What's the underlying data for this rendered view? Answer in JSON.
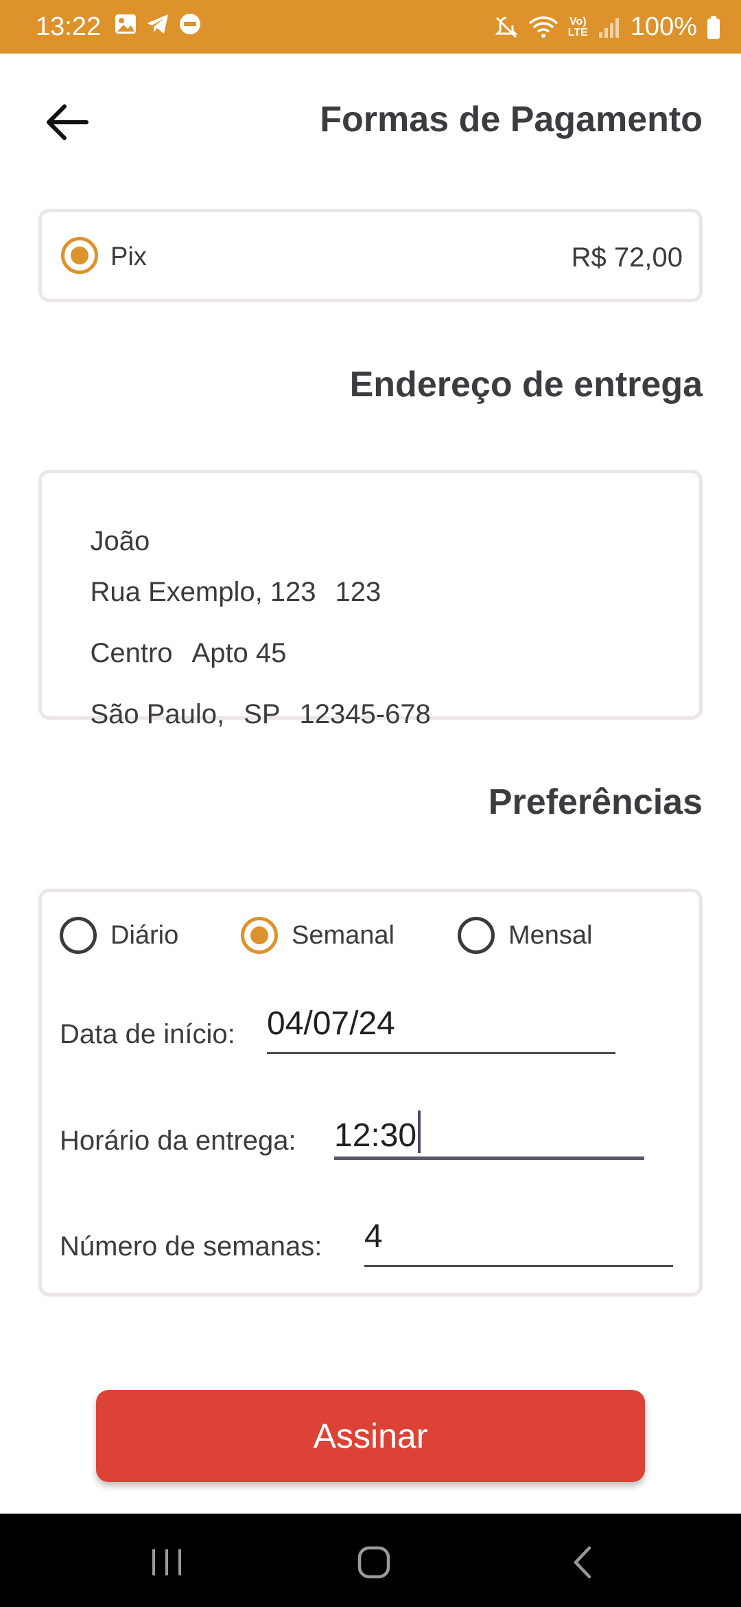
{
  "status_bar": {
    "time": "13:22",
    "battery_text": "100%",
    "icons": [
      "image-icon",
      "telegram-icon",
      "dnd-icon",
      "mute-icon",
      "wifi-icon",
      "volte-icon",
      "signal-icon",
      "battery-icon"
    ]
  },
  "header": {
    "title": "Formas de Pagamento",
    "back_icon": "arrow-left-icon"
  },
  "payment": {
    "method_label": "Pix",
    "price": "R$ 72,00",
    "selected": true
  },
  "address": {
    "title": "Endereço de entrega",
    "name": "João",
    "street": "Rua Exemplo, 123",
    "number": "123",
    "district": "Centro",
    "complement": "Apto 45",
    "city": "São Paulo,",
    "state": "SP",
    "zip": "12345-678"
  },
  "preferences": {
    "title": "Preferências",
    "frequency_options": [
      {
        "label": "Diário",
        "selected": false
      },
      {
        "label": "Semanal",
        "selected": true
      },
      {
        "label": "Mensal",
        "selected": false
      }
    ],
    "start_date_label": "Data de início:",
    "start_date_value": "04/07/24",
    "delivery_time_label": "Horário da entrega:",
    "delivery_time_value": "12:30",
    "weeks_label": "Número de semanas:",
    "weeks_value": "4"
  },
  "submit_label": "Assinar",
  "colors": {
    "accent": "#dd922b",
    "button": "#dd4236"
  }
}
